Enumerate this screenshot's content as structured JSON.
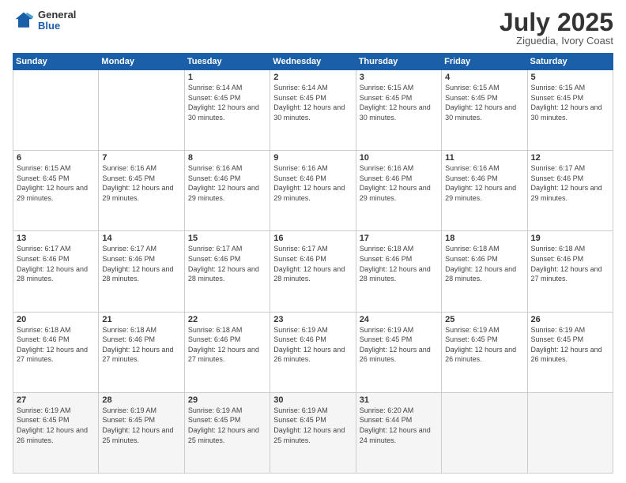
{
  "header": {
    "logo": {
      "general": "General",
      "blue": "Blue"
    },
    "title": "July 2025",
    "subtitle": "Ziguedia, Ivory Coast"
  },
  "weekdays": [
    "Sunday",
    "Monday",
    "Tuesday",
    "Wednesday",
    "Thursday",
    "Friday",
    "Saturday"
  ],
  "weeks": [
    [
      {
        "day": "",
        "info": ""
      },
      {
        "day": "",
        "info": ""
      },
      {
        "day": "1",
        "info": "Sunrise: 6:14 AM\nSunset: 6:45 PM\nDaylight: 12 hours and 30 minutes."
      },
      {
        "day": "2",
        "info": "Sunrise: 6:14 AM\nSunset: 6:45 PM\nDaylight: 12 hours and 30 minutes."
      },
      {
        "day": "3",
        "info": "Sunrise: 6:15 AM\nSunset: 6:45 PM\nDaylight: 12 hours and 30 minutes."
      },
      {
        "day": "4",
        "info": "Sunrise: 6:15 AM\nSunset: 6:45 PM\nDaylight: 12 hours and 30 minutes."
      },
      {
        "day": "5",
        "info": "Sunrise: 6:15 AM\nSunset: 6:45 PM\nDaylight: 12 hours and 30 minutes."
      }
    ],
    [
      {
        "day": "6",
        "info": "Sunrise: 6:15 AM\nSunset: 6:45 PM\nDaylight: 12 hours and 29 minutes."
      },
      {
        "day": "7",
        "info": "Sunrise: 6:16 AM\nSunset: 6:45 PM\nDaylight: 12 hours and 29 minutes."
      },
      {
        "day": "8",
        "info": "Sunrise: 6:16 AM\nSunset: 6:46 PM\nDaylight: 12 hours and 29 minutes."
      },
      {
        "day": "9",
        "info": "Sunrise: 6:16 AM\nSunset: 6:46 PM\nDaylight: 12 hours and 29 minutes."
      },
      {
        "day": "10",
        "info": "Sunrise: 6:16 AM\nSunset: 6:46 PM\nDaylight: 12 hours and 29 minutes."
      },
      {
        "day": "11",
        "info": "Sunrise: 6:16 AM\nSunset: 6:46 PM\nDaylight: 12 hours and 29 minutes."
      },
      {
        "day": "12",
        "info": "Sunrise: 6:17 AM\nSunset: 6:46 PM\nDaylight: 12 hours and 29 minutes."
      }
    ],
    [
      {
        "day": "13",
        "info": "Sunrise: 6:17 AM\nSunset: 6:46 PM\nDaylight: 12 hours and 28 minutes."
      },
      {
        "day": "14",
        "info": "Sunrise: 6:17 AM\nSunset: 6:46 PM\nDaylight: 12 hours and 28 minutes."
      },
      {
        "day": "15",
        "info": "Sunrise: 6:17 AM\nSunset: 6:46 PM\nDaylight: 12 hours and 28 minutes."
      },
      {
        "day": "16",
        "info": "Sunrise: 6:17 AM\nSunset: 6:46 PM\nDaylight: 12 hours and 28 minutes."
      },
      {
        "day": "17",
        "info": "Sunrise: 6:18 AM\nSunset: 6:46 PM\nDaylight: 12 hours and 28 minutes."
      },
      {
        "day": "18",
        "info": "Sunrise: 6:18 AM\nSunset: 6:46 PM\nDaylight: 12 hours and 28 minutes."
      },
      {
        "day": "19",
        "info": "Sunrise: 6:18 AM\nSunset: 6:46 PM\nDaylight: 12 hours and 27 minutes."
      }
    ],
    [
      {
        "day": "20",
        "info": "Sunrise: 6:18 AM\nSunset: 6:46 PM\nDaylight: 12 hours and 27 minutes."
      },
      {
        "day": "21",
        "info": "Sunrise: 6:18 AM\nSunset: 6:46 PM\nDaylight: 12 hours and 27 minutes."
      },
      {
        "day": "22",
        "info": "Sunrise: 6:18 AM\nSunset: 6:46 PM\nDaylight: 12 hours and 27 minutes."
      },
      {
        "day": "23",
        "info": "Sunrise: 6:19 AM\nSunset: 6:46 PM\nDaylight: 12 hours and 26 minutes."
      },
      {
        "day": "24",
        "info": "Sunrise: 6:19 AM\nSunset: 6:45 PM\nDaylight: 12 hours and 26 minutes."
      },
      {
        "day": "25",
        "info": "Sunrise: 6:19 AM\nSunset: 6:45 PM\nDaylight: 12 hours and 26 minutes."
      },
      {
        "day": "26",
        "info": "Sunrise: 6:19 AM\nSunset: 6:45 PM\nDaylight: 12 hours and 26 minutes."
      }
    ],
    [
      {
        "day": "27",
        "info": "Sunrise: 6:19 AM\nSunset: 6:45 PM\nDaylight: 12 hours and 26 minutes."
      },
      {
        "day": "28",
        "info": "Sunrise: 6:19 AM\nSunset: 6:45 PM\nDaylight: 12 hours and 25 minutes."
      },
      {
        "day": "29",
        "info": "Sunrise: 6:19 AM\nSunset: 6:45 PM\nDaylight: 12 hours and 25 minutes."
      },
      {
        "day": "30",
        "info": "Sunrise: 6:19 AM\nSunset: 6:45 PM\nDaylight: 12 hours and 25 minutes."
      },
      {
        "day": "31",
        "info": "Sunrise: 6:20 AM\nSunset: 6:44 PM\nDaylight: 12 hours and 24 minutes."
      },
      {
        "day": "",
        "info": ""
      },
      {
        "day": "",
        "info": ""
      }
    ]
  ]
}
